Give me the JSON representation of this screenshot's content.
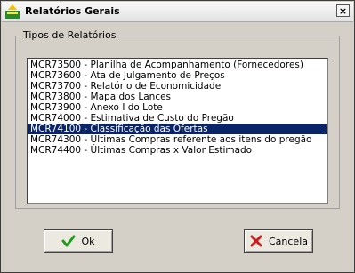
{
  "window": {
    "title": "Relatórios Gerais",
    "close_label": "×"
  },
  "group": {
    "label": "Tipos de Relatórios"
  },
  "reports": [
    {
      "label": "MCR73500 - Planilha de Acompanhamento (Fornecedores)",
      "selected": false
    },
    {
      "label": "MCR73600 - Ata de Julgamento de Preços",
      "selected": false
    },
    {
      "label": "MCR73700 - Relatório de Economicidade",
      "selected": false
    },
    {
      "label": "MCR73800 - Mapa dos Lances",
      "selected": false
    },
    {
      "label": "MCR73900 - Anexo I do Lote",
      "selected": false
    },
    {
      "label": "MCR74000 - Estimativa de Custo do Pregão",
      "selected": false
    },
    {
      "label": "MCR74100 - Classificação das Ofertas",
      "selected": true
    },
    {
      "label": "MCR74300 - Últimas Compras referente aos itens do pregão",
      "selected": false
    },
    {
      "label": "MCR74400 - Últimas Compras x Valor Estimado",
      "selected": false
    }
  ],
  "buttons": {
    "ok": "Ok",
    "cancel": "Cancela"
  },
  "colors": {
    "selection": "#0a246a",
    "face": "#d4d0c8"
  }
}
